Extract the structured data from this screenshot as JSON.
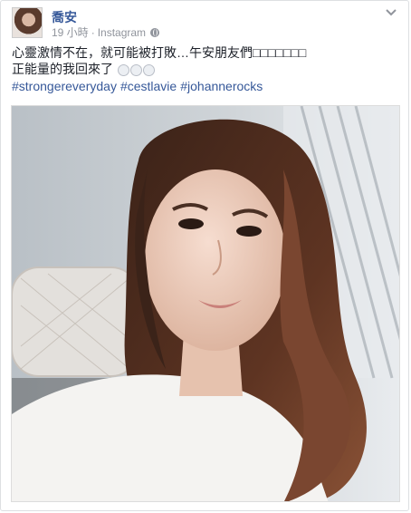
{
  "post": {
    "author": "喬安",
    "time": "19 小時",
    "source": "Instagram",
    "text_line1": "心靈激情不在，就可能被打敗…午安朋友們",
    "text_line1_tail": "□□□□□□□",
    "text_line2": "正能量的我回來了",
    "hashtags": [
      "#strongereveryday",
      "#cestlavie",
      "#johannerocks"
    ]
  },
  "icons": {
    "globe": "globe-icon",
    "chevron": "chevron-down-icon",
    "emoji": "ghost-emoji-icon"
  },
  "colors": {
    "link": "#365899",
    "meta": "#90949c",
    "text": "#1d2129"
  }
}
